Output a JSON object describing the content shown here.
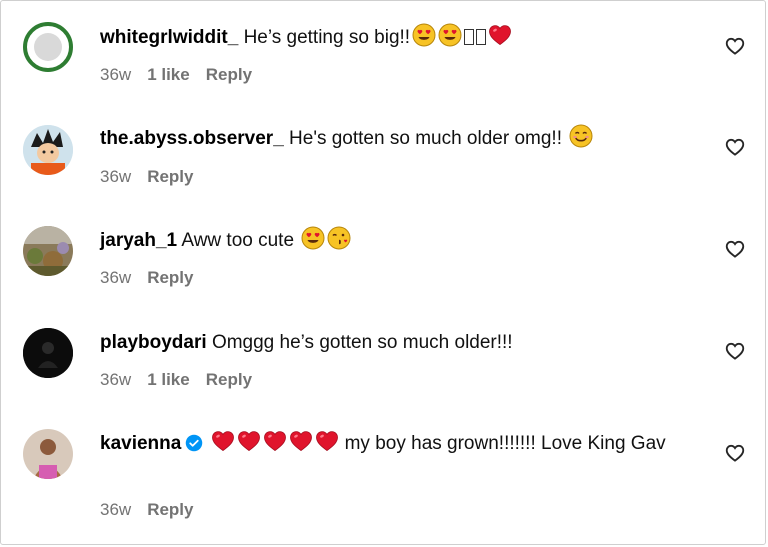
{
  "comments": [
    {
      "username": "whitegrlwiddit_",
      "text": "He’s getting so big!!",
      "time": "36w",
      "likes": "1 like",
      "reply": "Reply"
    },
    {
      "username": "the.abyss.observer_",
      "text": "He's gotten so much older omg!!",
      "time": "36w",
      "reply": "Reply"
    },
    {
      "username": "jaryah_1",
      "text": "Aww too cute",
      "time": "36w",
      "reply": "Reply"
    },
    {
      "username": "playboydari",
      "text": "Omggg he’s gotten so much older!!!",
      "time": "36w",
      "likes": "1 like",
      "reply": "Reply"
    },
    {
      "username": "kavienna",
      "text": "my boy has grown!!!!!!! Love King Gav",
      "time": "36w",
      "reply": "Reply"
    }
  ],
  "icons": {
    "like": "heart-outline-icon",
    "verified": "verified-badge-icon",
    "emoji_heart_eyes": "heart-eyes-emoji",
    "emoji_smile": "smiling-face-emoji",
    "emoji_kiss": "kissing-face-emoji",
    "emoji_red_heart": "red-heart-emoji"
  },
  "colors": {
    "meta_text": "#737373",
    "verified_blue": "#0095f6",
    "emoji_yellow": "#f7c325",
    "red_heart": "#e0142c"
  }
}
